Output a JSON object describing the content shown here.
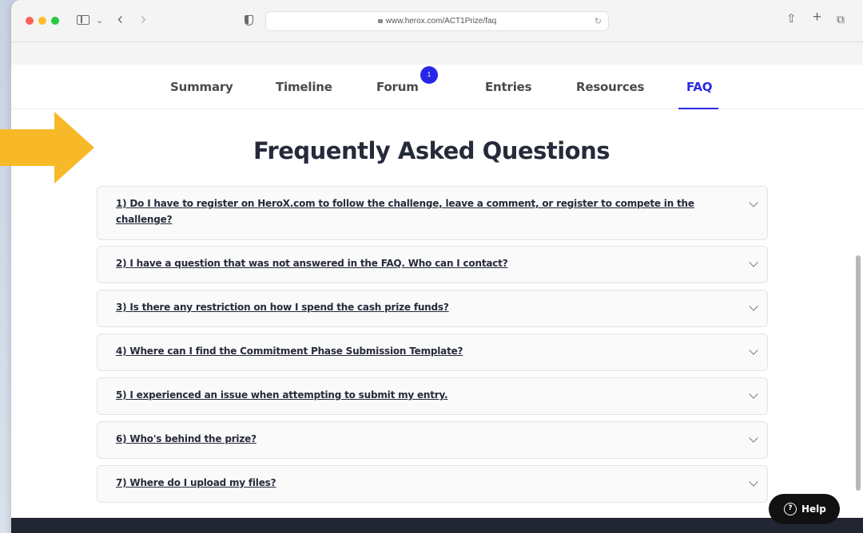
{
  "browser": {
    "url": "www.herox.com/ACT1Prize/faq",
    "back_glyph": "‹",
    "forward_glyph": "›",
    "chevron_glyph": "⌄",
    "share_glyph": "⇧",
    "newtab_glyph": "+",
    "tabs_glyph": "⧉",
    "reload_glyph": "↻"
  },
  "nav": {
    "tabs": [
      {
        "label": "Summary"
      },
      {
        "label": "Timeline"
      },
      {
        "label": "Forum",
        "badge": "1"
      },
      {
        "label": "Entries"
      },
      {
        "label": "Resources"
      },
      {
        "label": "FAQ",
        "active": true
      }
    ]
  },
  "faq": {
    "title": "Frequently Asked Questions",
    "items": [
      {
        "question": "1) Do I have to register on HeroX.com to follow the challenge, leave a comment, or register to compete in the challenge?"
      },
      {
        "question": "2) I have a question that was not answered in the FAQ. Who can I contact?"
      },
      {
        "question": "3) Is there any restriction on how I spend the cash prize funds?"
      },
      {
        "question": "4) Where can I find the Commitment Phase Submission Template?"
      },
      {
        "question": "5) I experienced an issue when attempting to submit my entry."
      },
      {
        "question": "6) Who's behind the prize?"
      },
      {
        "question": "7) Where do I upload my files?"
      }
    ]
  },
  "help": {
    "label": "Help",
    "icon_glyph": "?"
  },
  "colors": {
    "accent": "#2a2ae6",
    "annotation_arrow": "#f7b928",
    "footer": "#222633",
    "title_text": "#262b3b"
  },
  "icons": {
    "annotation": "arrow-right-icon",
    "faq_toggle": "chevron-down-icon",
    "help": "question-circle-icon"
  }
}
